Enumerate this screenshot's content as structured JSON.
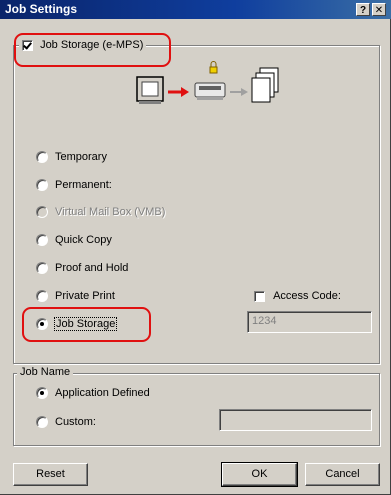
{
  "window": {
    "title": "Job Settings",
    "help_label": "?",
    "close_label": "✕"
  },
  "job_storage": {
    "checkbox_label": "Job Storage (e-MPS)",
    "checked": true,
    "options": [
      {
        "label": "Temporary",
        "selected": false,
        "enabled": true
      },
      {
        "label": "Permanent:",
        "selected": false,
        "enabled": true
      },
      {
        "label": "Virtual Mail Box (VMB)",
        "selected": false,
        "enabled": false
      },
      {
        "label": "Quick Copy",
        "selected": false,
        "enabled": true
      },
      {
        "label": "Proof and Hold",
        "selected": false,
        "enabled": true
      },
      {
        "label": "Private Print",
        "selected": false,
        "enabled": true
      },
      {
        "label": "Job Storage",
        "selected": true,
        "enabled": true
      }
    ],
    "access_code_label": "Access Code:",
    "access_code_checked": false,
    "access_code_value": "1234"
  },
  "job_name": {
    "group_label": "Job Name",
    "options": [
      {
        "label": "Application Defined",
        "selected": true
      },
      {
        "label": "Custom:",
        "selected": false
      }
    ],
    "custom_value": ""
  },
  "buttons": {
    "reset": "Reset",
    "ok": "OK",
    "cancel": "Cancel"
  },
  "icons": [
    "monitor-icon",
    "red-arrow-icon",
    "printer-lock-icon",
    "gray-arrow-icon",
    "pages-stack-icon"
  ],
  "colors": {
    "title_bar": "#0a246a",
    "highlight": "#e01010",
    "dialog_face": "#d4d0c8"
  }
}
